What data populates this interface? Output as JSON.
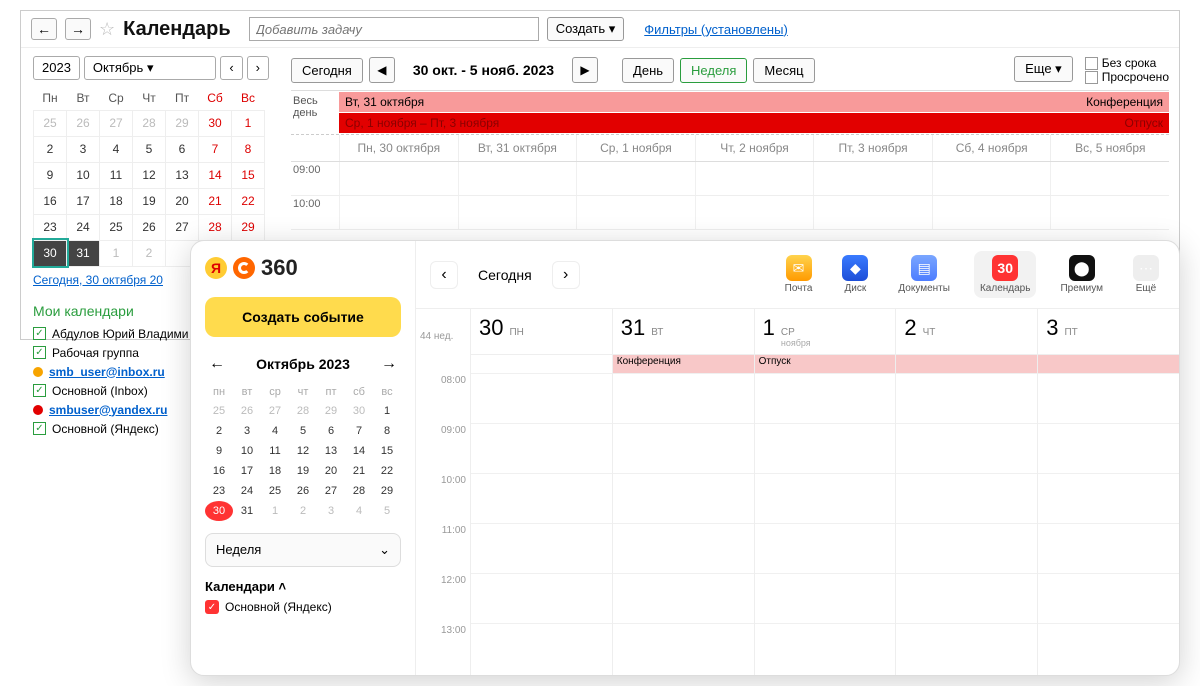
{
  "win1": {
    "title": "Календарь",
    "add_task_placeholder": "Добавить задачу",
    "create_btn": "Создать ▾",
    "filters_link": "Фильтры (установлены)",
    "year": "2023",
    "month": "Октябрь",
    "wdays": [
      "Пн",
      "Вт",
      "Ср",
      "Чт",
      "Пт",
      "Сб",
      "Вс"
    ],
    "mini_rows": [
      [
        {
          "d": "25",
          "dim": true
        },
        {
          "d": "26",
          "dim": true
        },
        {
          "d": "27",
          "dim": true
        },
        {
          "d": "28",
          "dim": true
        },
        {
          "d": "29",
          "dim": true
        },
        {
          "d": "30",
          "dim": true,
          "wknd": true
        },
        {
          "d": "1",
          "wknd": true
        }
      ],
      [
        {
          "d": "2"
        },
        {
          "d": "3"
        },
        {
          "d": "4"
        },
        {
          "d": "5"
        },
        {
          "d": "6"
        },
        {
          "d": "7",
          "wknd": true
        },
        {
          "d": "8",
          "wknd": true
        }
      ],
      [
        {
          "d": "9"
        },
        {
          "d": "10"
        },
        {
          "d": "11"
        },
        {
          "d": "12"
        },
        {
          "d": "13"
        },
        {
          "d": "14",
          "wknd": true
        },
        {
          "d": "15",
          "wknd": true
        }
      ],
      [
        {
          "d": "16"
        },
        {
          "d": "17"
        },
        {
          "d": "18"
        },
        {
          "d": "19"
        },
        {
          "d": "20"
        },
        {
          "d": "21",
          "wknd": true
        },
        {
          "d": "22",
          "wknd": true
        }
      ],
      [
        {
          "d": "23"
        },
        {
          "d": "24"
        },
        {
          "d": "25"
        },
        {
          "d": "26"
        },
        {
          "d": "27"
        },
        {
          "d": "28",
          "wknd": true
        },
        {
          "d": "29",
          "wknd": true
        }
      ],
      [
        {
          "d": "30",
          "sel": "sel30"
        },
        {
          "d": "31",
          "sel": "sel31"
        },
        {
          "d": "1",
          "dim": true
        },
        {
          "d": "2",
          "dim": true
        },
        {
          "d": "",
          "dim": true
        },
        {
          "d": "",
          "dim": true
        },
        {
          "d": "",
          "dim": true
        }
      ]
    ],
    "today_link": "Сегодня, 30 октября 20",
    "mycal_header": "Мои календари",
    "calendars": [
      {
        "type": "chk",
        "label": "Абдулов Юрий Владими"
      },
      {
        "type": "chk",
        "label": "Рабочая группа"
      },
      {
        "type": "dot",
        "color": "#f7a400",
        "link": "smb_user@inbox.ru"
      },
      {
        "type": "chk",
        "label": "Основной (Inbox)"
      },
      {
        "type": "dot",
        "color": "#e20000",
        "link": "smbuser@yandex.ru"
      },
      {
        "type": "chk",
        "label": "Основной (Яндекс)"
      }
    ],
    "toolbar": {
      "today": "Сегодня",
      "range": "30 окт. - 5 нояб. 2023",
      "day": "День",
      "week": "Неделя",
      "month": "Месяц",
      "more": "Еще ▾",
      "no_deadline": "Без срока",
      "overdue": "Просрочено"
    },
    "allday_label": "Весь день",
    "events": [
      {
        "left": "Вт, 31 октября",
        "right": "Конференция",
        "cls": "ev1"
      },
      {
        "left": "Ср, 1 ноября – Пт, 3 ноября",
        "right": "Отпуск",
        "cls": "ev2"
      }
    ],
    "day_headers": [
      "Пн, 30 октября",
      "Вт, 31 октября",
      "Ср, 1 ноября",
      "Чт, 2 ноября",
      "Пт, 3 ноября",
      "Сб, 4 ноября",
      "Вс, 5 ноября"
    ],
    "hours": [
      "09:00",
      "10:00"
    ]
  },
  "win2": {
    "logo_text": "360",
    "create_event": "Создать событие",
    "today": "Сегодня",
    "mini_month": "Октябрь 2023",
    "wdays": [
      "пн",
      "вт",
      "ср",
      "чт",
      "пт",
      "сб",
      "вс"
    ],
    "mini_rows": [
      [
        {
          "d": "25",
          "dim": true
        },
        {
          "d": "26",
          "dim": true
        },
        {
          "d": "27",
          "dim": true
        },
        {
          "d": "28",
          "dim": true
        },
        {
          "d": "29",
          "dim": true
        },
        {
          "d": "30",
          "dim": true
        },
        {
          "d": "1"
        }
      ],
      [
        {
          "d": "2"
        },
        {
          "d": "3"
        },
        {
          "d": "4"
        },
        {
          "d": "5"
        },
        {
          "d": "6"
        },
        {
          "d": "7"
        },
        {
          "d": "8"
        }
      ],
      [
        {
          "d": "9"
        },
        {
          "d": "10"
        },
        {
          "d": "11"
        },
        {
          "d": "12"
        },
        {
          "d": "13"
        },
        {
          "d": "14"
        },
        {
          "d": "15"
        }
      ],
      [
        {
          "d": "16"
        },
        {
          "d": "17"
        },
        {
          "d": "18"
        },
        {
          "d": "19"
        },
        {
          "d": "20"
        },
        {
          "d": "21"
        },
        {
          "d": "22"
        }
      ],
      [
        {
          "d": "23"
        },
        {
          "d": "24"
        },
        {
          "d": "25"
        },
        {
          "d": "26"
        },
        {
          "d": "27"
        },
        {
          "d": "28"
        },
        {
          "d": "29"
        }
      ],
      [
        {
          "d": "30",
          "today": true
        },
        {
          "d": "31"
        },
        {
          "d": "1",
          "dim": true
        },
        {
          "d": "2",
          "dim": true
        },
        {
          "d": "3",
          "dim": true
        },
        {
          "d": "4",
          "dim": true
        },
        {
          "d": "5",
          "dim": true
        }
      ]
    ],
    "view_label": "Неделя",
    "cal_header": "Календари",
    "cal_item": "Основной (Яндекс)",
    "apps": [
      {
        "name": "Почта",
        "ic": "ic-mail",
        "glyph": "✉"
      },
      {
        "name": "Диск",
        "ic": "ic-disk",
        "glyph": "◆"
      },
      {
        "name": "Документы",
        "ic": "ic-docs",
        "glyph": "▤"
      },
      {
        "name": "Календарь",
        "ic": "ic-cal",
        "glyph": "30",
        "sel": true
      },
      {
        "name": "Премиум",
        "ic": "ic-prem",
        "glyph": "⬤"
      },
      {
        "name": "Ещё",
        "ic": "ic-more",
        "glyph": "⋯"
      }
    ],
    "week_label": "44 нед.",
    "days": [
      {
        "num": "30",
        "dw": "ПН",
        "mo": "",
        "allday": ""
      },
      {
        "num": "31",
        "dw": "ВТ",
        "mo": "",
        "allday": "Конференция"
      },
      {
        "num": "1",
        "dw": "СР",
        "mo": "ноября",
        "allday": "Отпуск"
      },
      {
        "num": "2",
        "dw": "ЧТ",
        "mo": "",
        "allday": " "
      },
      {
        "num": "3",
        "dw": "ПТ",
        "mo": "",
        "allday": " "
      }
    ],
    "hours": [
      "08:00",
      "09:00",
      "10:00",
      "11:00",
      "12:00",
      "13:00"
    ]
  }
}
